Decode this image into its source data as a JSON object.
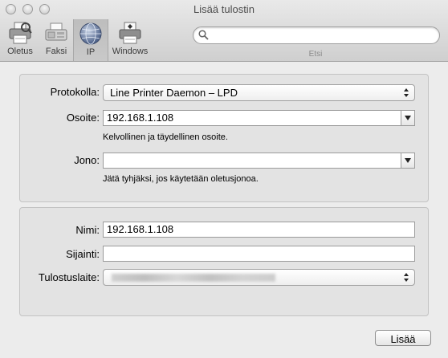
{
  "window": {
    "title": "Lisää tulostin"
  },
  "toolbar": {
    "items": [
      {
        "label": "Oletus",
        "icon": "default-printer-icon"
      },
      {
        "label": "Faksi",
        "icon": "fax-icon"
      },
      {
        "label": "IP",
        "icon": "ip-globe-icon",
        "selected": true
      },
      {
        "label": "Windows",
        "icon": "windows-printer-icon"
      }
    ],
    "search": {
      "value": "",
      "placeholder": "",
      "label": "Etsi"
    }
  },
  "connection": {
    "protocol_label": "Protokolla:",
    "protocol_value": "Line Printer Daemon – LPD",
    "address_label": "Osoite:",
    "address_value": "192.168.1.108",
    "address_hint": "Kelvollinen ja täydellinen osoite.",
    "queue_label": "Jono:",
    "queue_value": "",
    "queue_hint": "Jätä tyhjäksi, jos käytetään oletusjonoa."
  },
  "details": {
    "name_label": "Nimi:",
    "name_value": "192.168.1.108",
    "location_label": "Sijainti:",
    "location_value": "",
    "use_label": "Tulostuslaite:"
  },
  "footer": {
    "add_label": "Lisää"
  },
  "colors": {
    "window_bg": "#ececec",
    "group_bg": "#e3e3e3",
    "selected_tab": "#c4c4c4"
  }
}
